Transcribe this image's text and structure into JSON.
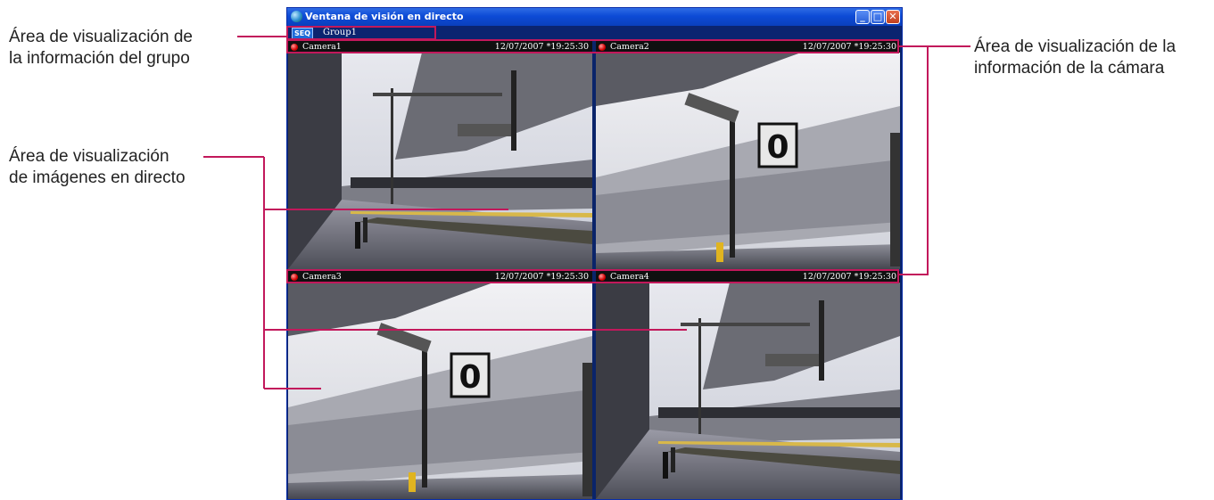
{
  "callouts": {
    "group_info": {
      "line1": "Área de visualización de",
      "line2": "la información del grupo"
    },
    "live_images": {
      "line1": "Área de visualización",
      "line2": "de imágenes en directo"
    },
    "camera_info": {
      "line1": "Área de visualización de la",
      "line2": "información de la cámara"
    }
  },
  "window": {
    "title": "Ventana de visión en directo",
    "buttons": {
      "minimize": "_",
      "maximize": "□",
      "close": "✕"
    }
  },
  "group": {
    "seq_label": "SEQ",
    "name": "Group1"
  },
  "cameras": [
    {
      "name": "Camera1",
      "timestamp": "12/07/2007 *19:25:30"
    },
    {
      "name": "Camera2",
      "timestamp": "12/07/2007 *19:25:30"
    },
    {
      "name": "Camera3",
      "timestamp": "12/07/2007 *19:25:30"
    },
    {
      "name": "Camera4",
      "timestamp": "12/07/2007 *19:25:30"
    }
  ],
  "sign_number": "0",
  "colors": {
    "callout_line": "#c2185b",
    "title_bar": "#0d4bd6",
    "window_bg": "#0a246a",
    "rec_dot": "#d40000"
  }
}
